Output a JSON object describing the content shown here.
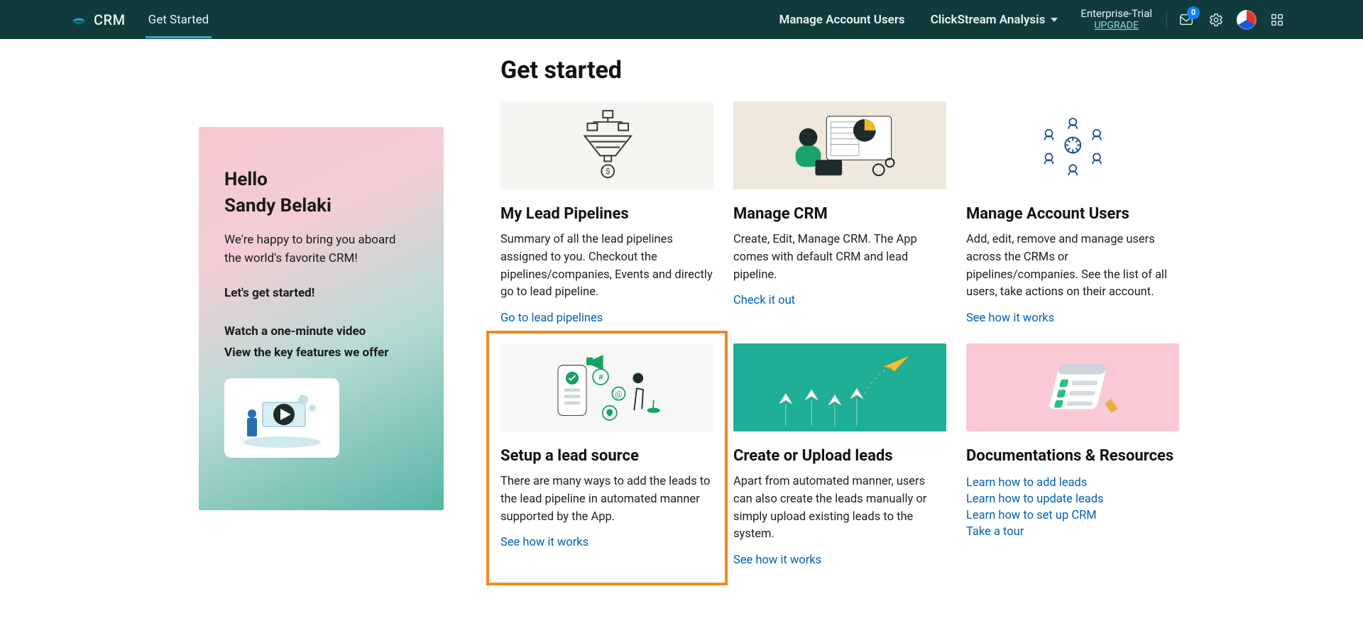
{
  "header": {
    "brand": "CRM",
    "active_tab": "Get Started",
    "nav": {
      "manage_users": "Manage Account Users",
      "clickstream": "ClickStream Analysis"
    },
    "trial": {
      "plan": "Enterprise-Trial",
      "upgrade": "UPGRADE"
    },
    "notif_count": "0"
  },
  "page_title": "Get started",
  "welcome": {
    "hello": "Hello",
    "user_name": "Sandy Belaki",
    "intro": "We're happy to bring you aboard the world's favorite CRM!",
    "lets": "Let's get started!",
    "watch": "Watch a one-minute video",
    "view_features": "View the key features we offer"
  },
  "cards": {
    "pipelines": {
      "title": "My Lead Pipelines",
      "desc": "Summary of all the lead pipelines assigned to you. Checkout the pipelines/companies, Events and directly go to lead pipeline.",
      "link": "Go to lead pipelines"
    },
    "manage_crm": {
      "title": "Manage CRM",
      "desc": "Create, Edit, Manage CRM. The App comes with default CRM and lead pipeline.",
      "link": "Check it out"
    },
    "manage_users": {
      "title": "Manage Account Users",
      "desc": "Add, edit, remove and manage users across the CRMs or pipelines/companies. See the list of all users, take actions on their account.",
      "link": "See how it works"
    },
    "lead_source": {
      "title": "Setup a lead source",
      "desc": "There are many ways to add the leads to the lead pipeline in automated manner supported by the App.",
      "link": "See how it works"
    },
    "create_leads": {
      "title": "Create or Upload leads",
      "desc": "Apart from automated manner, users can also create the leads manually or simply upload existing leads to the system.",
      "link": "See how it works"
    },
    "docs": {
      "title": "Documentations & Resources",
      "links": {
        "add": "Learn how to add leads",
        "update": "Learn how to update leads",
        "setup": "Learn how to set up CRM",
        "tour": "Take a tour"
      }
    }
  }
}
